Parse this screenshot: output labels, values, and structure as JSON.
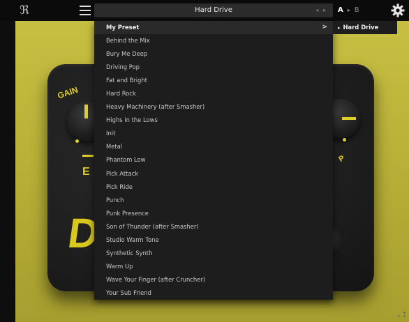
{
  "topbar": {
    "brand_glyph": "ℜ",
    "preset_name": "Hard Drive",
    "preset_arrows": "◂ ▸",
    "ab": {
      "a": "A",
      "arrow": "▸",
      "b": "B"
    }
  },
  "pedal": {
    "gain_label": "GAIN",
    "letter_e": "E",
    "logo": "D",
    "label_p": "P"
  },
  "dropdown": {
    "items": [
      "My Preset",
      "Behind the Mix",
      "Bury Me Deep",
      "Driving Pop",
      "Fat and Bright",
      "Hard Rock",
      "Heavy Machinery (after Smasher)",
      "Highs in the Lows",
      "Init",
      "Metal",
      "Phantom Low",
      "Pick Attack",
      "Pick Ride",
      "Punch",
      "Punk Presence",
      "Son of Thunder (after Smasher)",
      "Studio Warm Tone",
      "Synthetic Synth",
      "Warm Up",
      "Wave Your Finger (after Cruncher)",
      "Your Sub Friend"
    ],
    "chevron": ">"
  },
  "submenu": {
    "tri": "▸",
    "item": "Hard Drive"
  },
  "icons": [
    "brand-logo-icon",
    "menu-icon",
    "chevron-right-icon",
    "settings-gear-icon",
    "resize-grip-icon"
  ],
  "colors": {
    "accent": "#e0cf2a",
    "background": "#b6ad36",
    "menu_bg": "#1d1d1d"
  }
}
